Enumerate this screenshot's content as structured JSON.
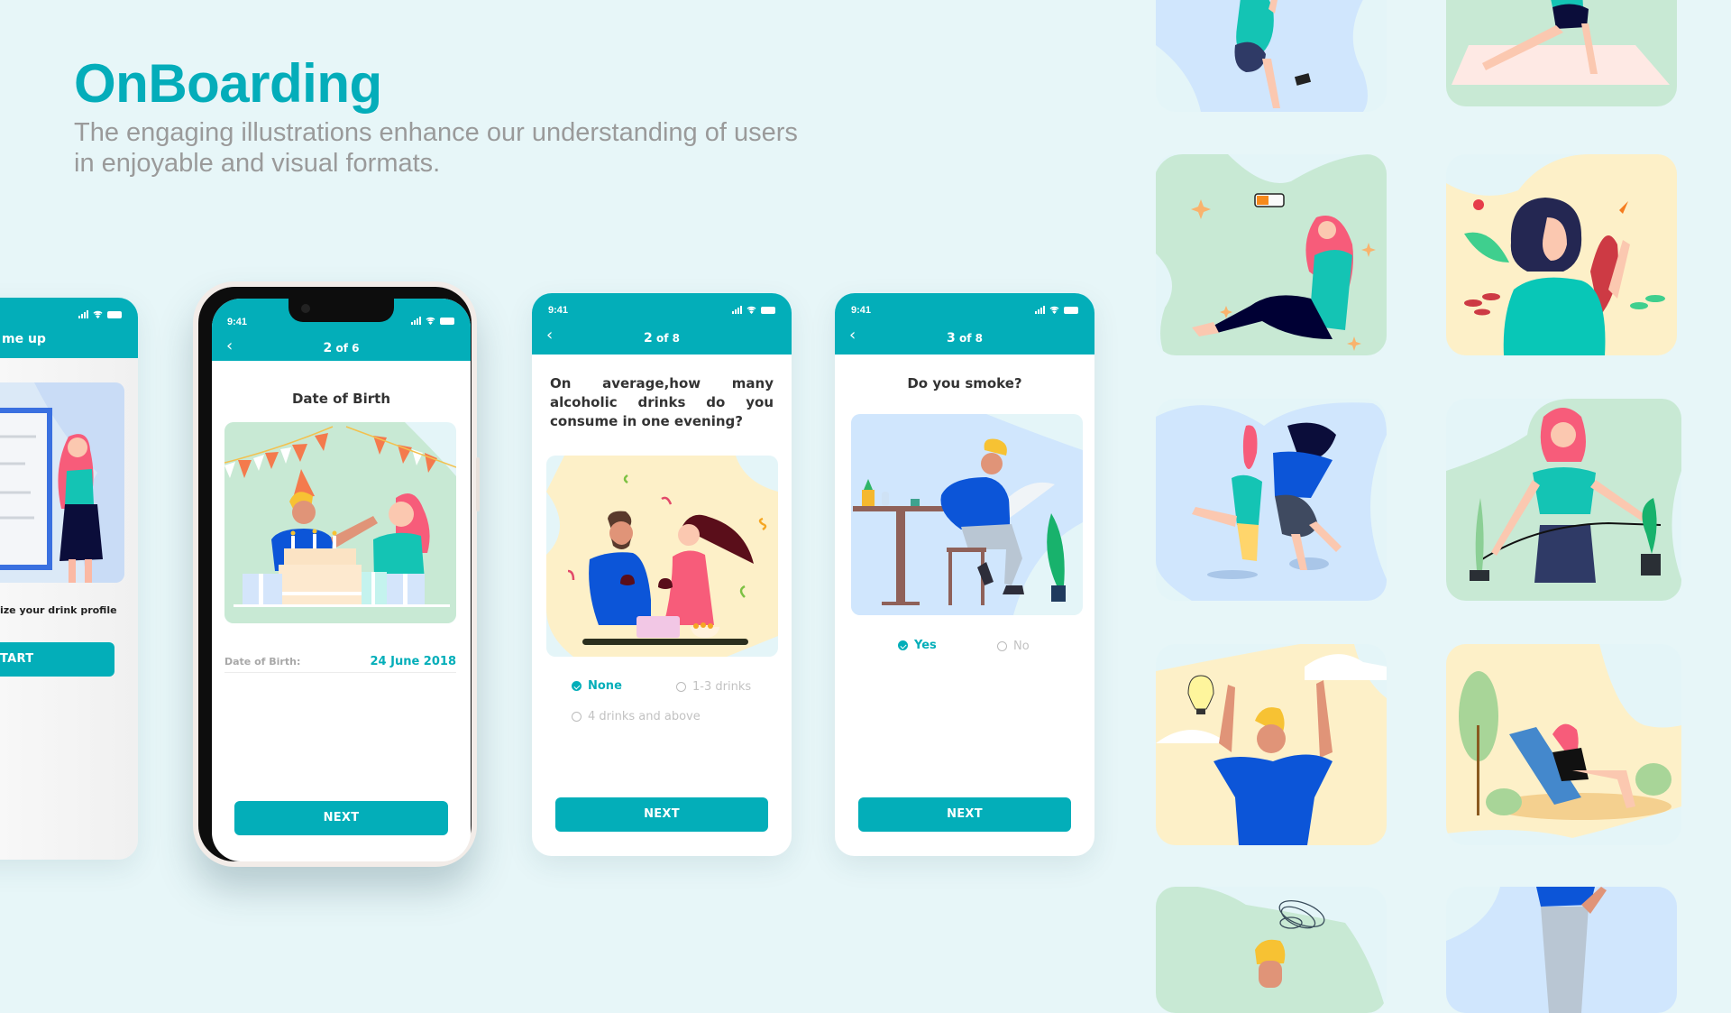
{
  "header": {
    "title": "OnBoarding",
    "subtitle_line1": "The engaging illustrations enhance our understanding of users",
    "subtitle_line2": "in enjoyable and visual formats."
  },
  "colors": {
    "accent": "#03aeb9",
    "background": "#e7f6f8",
    "subtitle": "#9a9a9a"
  },
  "screens": {
    "signup": {
      "title_partial": "me up",
      "caption_partial": "ize your drink profile",
      "button_partial": "TART",
      "illustration": "woman-with-clipboard"
    },
    "dob": {
      "time": "9:41",
      "step_current": "2",
      "step_of": "of 6",
      "heading": "Date of Birth",
      "illustration": "birthday-party",
      "field_label": "Date of Birth:",
      "field_value": "24 June 2018",
      "next_label": "NEXT"
    },
    "alcohol": {
      "time": "9:41",
      "step_current": "2",
      "step_of": "of 8",
      "question": "On average,how many alcoholic drinks do you consume in one evening?",
      "illustration": "couple-with-wine",
      "options": [
        {
          "label": "None",
          "selected": true
        },
        {
          "label": "1-3 drinks",
          "selected": false
        },
        {
          "label": "4 drinks and above",
          "selected": false
        }
      ],
      "next_label": "NEXT"
    },
    "smoke": {
      "time": "9:41",
      "step_current": "3",
      "step_of": "of 8",
      "question": "Do you smoke?",
      "illustration": "man-smoking-at-table",
      "options": [
        {
          "label": "Yes",
          "selected": true
        },
        {
          "label": "No",
          "selected": false
        }
      ],
      "next_label": "NEXT"
    }
  },
  "icons": {
    "back": "chevron-left-icon",
    "signal": "signal-icon",
    "wifi": "wifi-icon",
    "battery": "battery-icon",
    "check": "check-circle-icon",
    "radio": "radio-empty-icon"
  },
  "gallery": [
    {
      "name": "woman-climbing",
      "bg": "#d0e6fd"
    },
    {
      "name": "woman-yoga-lunge",
      "bg": "#c8e9d4"
    },
    {
      "name": "woman-low-energy-battery",
      "bg": "#c8e9d4"
    },
    {
      "name": "woman-healthy-food",
      "bg": "#fdf0c8"
    },
    {
      "name": "friends-jumping",
      "bg": "#d0e6fd"
    },
    {
      "name": "woman-measuring-waist",
      "bg": "#c8e9d4"
    },
    {
      "name": "man-idea-lightbulb",
      "bg": "#fdf0c8"
    },
    {
      "name": "woman-relaxing-lounge-chair",
      "bg": "#fdf0c8"
    },
    {
      "name": "man-confused-scribble",
      "bg": "#c8e9d4"
    },
    {
      "name": "man-standing",
      "bg": "#d0e6fd"
    }
  ]
}
